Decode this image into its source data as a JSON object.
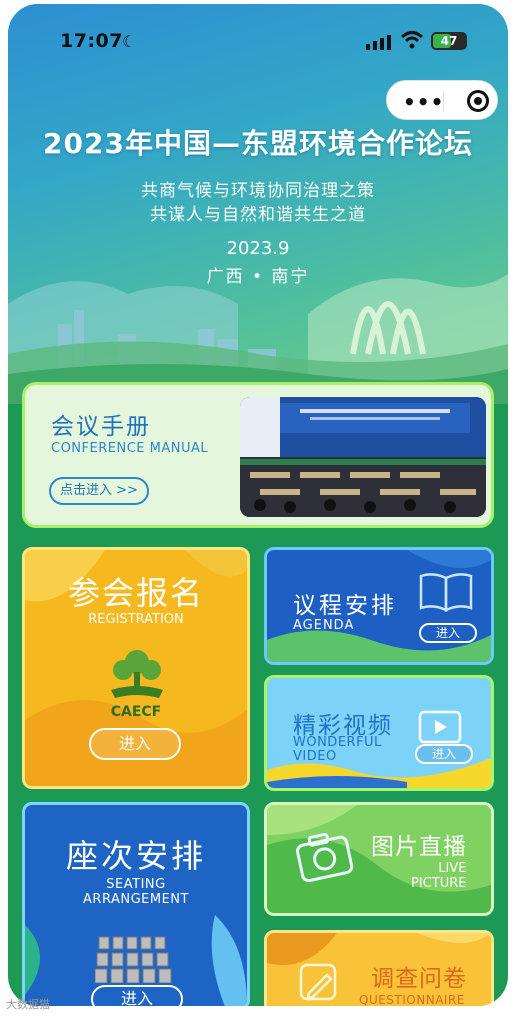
{
  "status_bar": {
    "time": "17:07",
    "battery": "47"
  },
  "hero": {
    "title": "2023年中国—东盟环境合作论坛",
    "subtitle_lines": [
      "共商气候与环境协同治理之策",
      "共谋人与自然和谐共生之道"
    ],
    "date": "2023.9",
    "location": "广西 • 南宁"
  },
  "manual": {
    "title": "会议手册",
    "subtitle": "CONFERENCE MANUAL",
    "button": "点击进入 >>"
  },
  "cards": {
    "registration": {
      "title": "参会报名",
      "subtitle": "REGISTRATION",
      "logo_text": "CAECF",
      "button": "进入"
    },
    "agenda": {
      "title": "议程安排",
      "subtitle": "AGENDA",
      "button": "进入"
    },
    "video": {
      "title": "精彩视频",
      "subtitle_lines": [
        "WONDERFUL",
        "VIDEO"
      ],
      "button": "进入"
    },
    "seating": {
      "title": "座次安排",
      "subtitle_lines": [
        "SEATING",
        "ARRANGEMENT"
      ],
      "button": "进入"
    },
    "live_picture": {
      "title": "图片直播",
      "subtitle_lines": [
        "LIVE",
        "PICTURE"
      ]
    },
    "questionnaire": {
      "title": "调查问卷",
      "subtitle": "QUESTIONNAIRE"
    }
  },
  "watermark": "大数据猫",
  "colors": {
    "hero_top": "#2d8fd2",
    "hero_bottom": "#74cf86",
    "body_green": "#1c9a55",
    "accent_blue": "#1e74b8",
    "accent_yellow": "#f6b81f"
  }
}
